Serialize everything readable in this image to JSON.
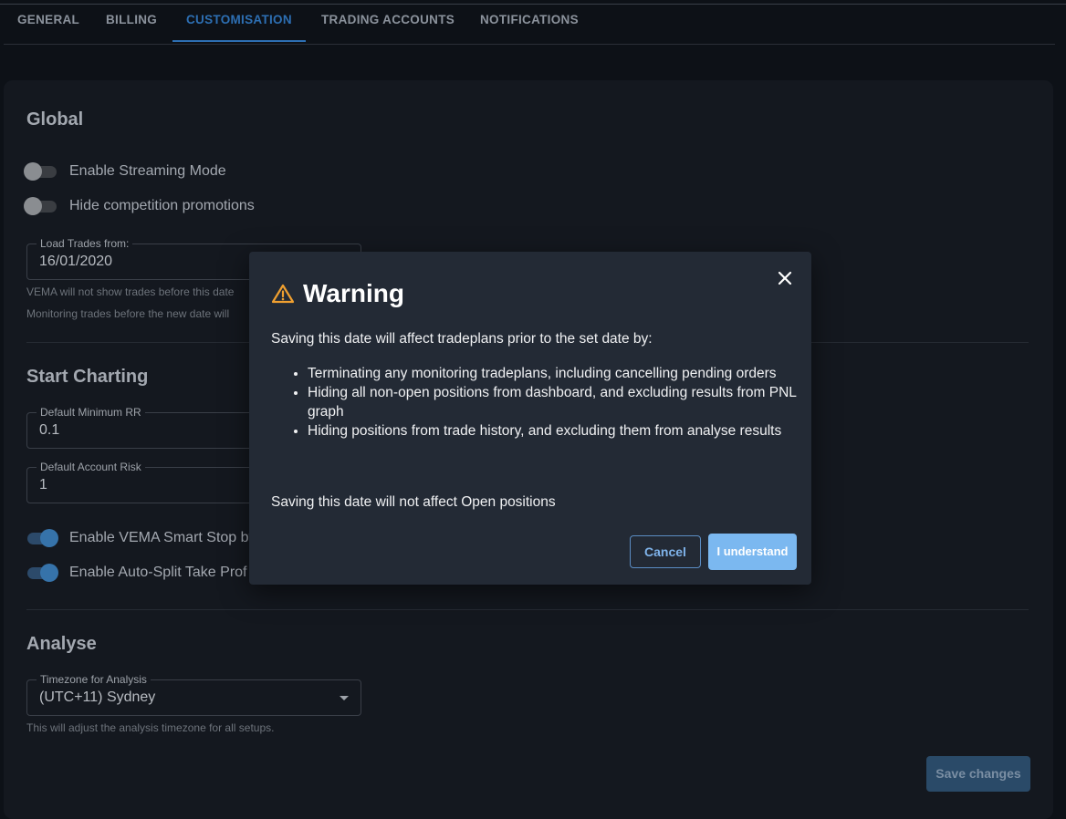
{
  "tabs": [
    {
      "label": "GENERAL",
      "active": false
    },
    {
      "label": "BILLING",
      "active": false
    },
    {
      "label": "CUSTOMISATION",
      "active": true
    },
    {
      "label": "TRADING ACCOUNTS",
      "active": false
    },
    {
      "label": "NOTIFICATIONS",
      "active": false
    }
  ],
  "global": {
    "title": "Global",
    "toggles": [
      {
        "label": "Enable Streaming Mode",
        "on": false
      },
      {
        "label": "Hide competition promotions",
        "on": false
      }
    ],
    "load_trades": {
      "label": "Load Trades from:",
      "value": "16/01/2020",
      "helper1": "VEMA will not show trades before this date",
      "helper2": "Monitoring trades before the new date will"
    }
  },
  "start_charting": {
    "title": "Start Charting",
    "min_rr": {
      "label": "Default Minimum RR",
      "value": "0.1"
    },
    "account_risk": {
      "label": "Default Account Risk",
      "value": "1"
    },
    "toggles": [
      {
        "label": "Enable VEMA Smart Stop by",
        "on": true
      },
      {
        "label": "Enable Auto-Split Take Prof",
        "on": true
      }
    ]
  },
  "analyse": {
    "title": "Analyse",
    "timezone": {
      "label": "Timezone for Analysis",
      "value": "(UTC+11) Sydney"
    },
    "helper": "This will adjust the analysis timezone for all setups."
  },
  "save_label": "Save changes",
  "modal": {
    "title": "Warning",
    "intro": "Saving this date will affect tradeplans prior to the set date by:",
    "bullets": [
      "Terminating any monitoring tradeplans, including cancelling pending orders",
      "Hiding all non-open positions from dashboard, and excluding results from PNL graph",
      "Hiding positions from trade history, and excluding them from analyse results"
    ],
    "outro": "Saving this date will not affect Open positions",
    "cancel_label": "Cancel",
    "confirm_label": "I understand"
  },
  "colors": {
    "background": "#0d1117",
    "accent": "#2d6fb3",
    "warning": "#f0a030",
    "modal_bg": "#232a35"
  }
}
